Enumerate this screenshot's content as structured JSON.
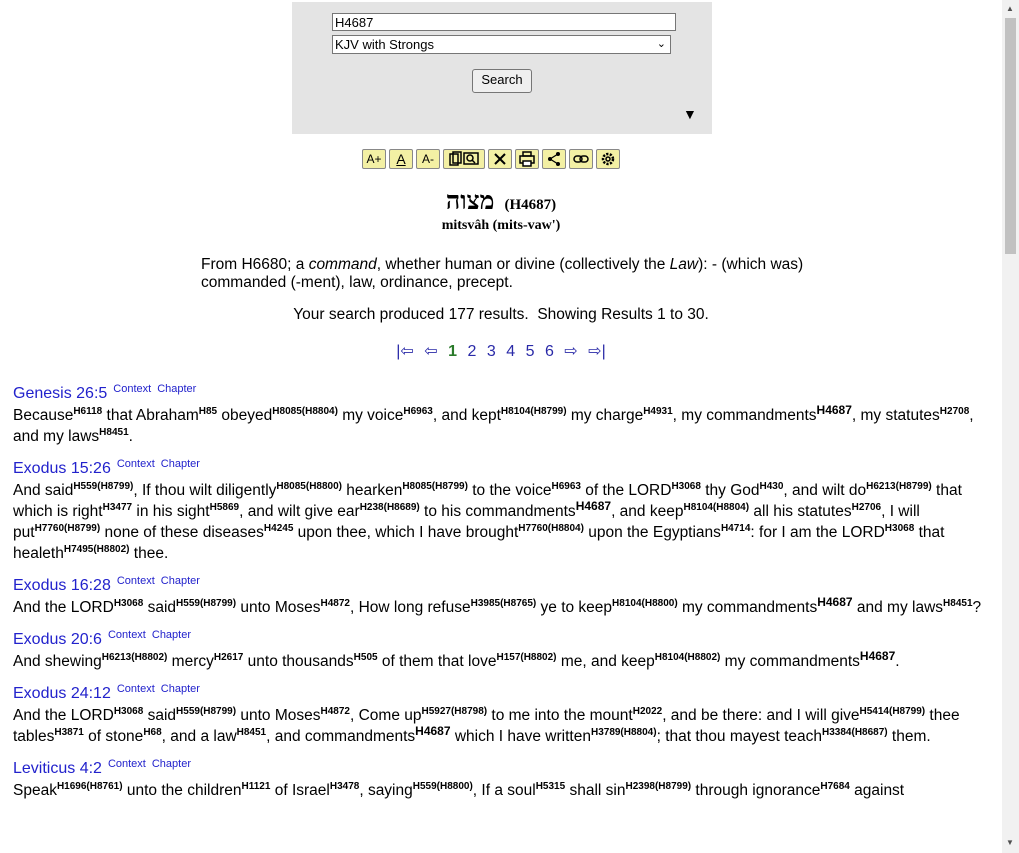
{
  "search": {
    "query": "H4687",
    "version": "KJV with Strongs",
    "button_label": "Search"
  },
  "toolbar": {
    "font_bigger": "A+",
    "font_normal": "A",
    "font_smaller": "A-"
  },
  "lexicon": {
    "hebrew": "מצוה",
    "strong": "(H4687)",
    "translit": "mitsvâh (mits-vaw')",
    "definition_parts": [
      "From H6680; a ",
      "command",
      ", whether human or divine (collectively the ",
      "Law",
      "): - (which was) commanded (-ment), law, ordinance, precept."
    ]
  },
  "result_count": "Your search produced 177 results.  Showing Results 1 to 30.",
  "pager": {
    "first": "|⇦",
    "prev": "⇦",
    "pages": [
      "1",
      "2",
      "3",
      "4",
      "5",
      "6"
    ],
    "next": "⇨",
    "last": "⇨|"
  },
  "link_labels": {
    "context": "Context",
    "chapter": "Chapter"
  },
  "verses": [
    {
      "ref": "Genesis 26:5",
      "segments": [
        [
          "Because",
          "H6118"
        ],
        [
          " that Abraham",
          "H85"
        ],
        [
          " obeyed",
          "H8085(H8804)"
        ],
        [
          " my voice",
          "H6963"
        ],
        [
          ", and kept",
          "H8104(H8799)"
        ],
        [
          " my charge",
          "H4931"
        ],
        [
          ", my commandments",
          "H4687"
        ],
        [
          ", my statutes",
          "H2708"
        ],
        [
          ", and my laws",
          "H8451"
        ],
        [
          ".",
          ""
        ]
      ]
    },
    {
      "ref": "Exodus 15:26",
      "segments": [
        [
          "And said",
          "H559(H8799)"
        ],
        [
          ", If thou wilt diligently",
          "H8085(H8800)"
        ],
        [
          " hearken",
          "H8085(H8799)"
        ],
        [
          " to the voice",
          "H6963"
        ],
        [
          " of the LORD",
          "H3068"
        ],
        [
          " thy God",
          "H430"
        ],
        [
          ", and wilt do",
          "H6213(H8799)"
        ],
        [
          " that which is right",
          "H3477"
        ],
        [
          " in his sight",
          "H5869"
        ],
        [
          ", and wilt give ear",
          "H238(H8689)"
        ],
        [
          " to his commandments",
          "H4687"
        ],
        [
          ", and keep",
          "H8104(H8804)"
        ],
        [
          " all his statutes",
          "H2706"
        ],
        [
          ", I will put",
          "H7760(H8799)"
        ],
        [
          " none of these diseases",
          "H4245"
        ],
        [
          " upon thee, which I have brought",
          "H7760(H8804)"
        ],
        [
          " upon the Egyptians",
          "H4714"
        ],
        [
          ": for I am the LORD",
          "H3068"
        ],
        [
          " that healeth",
          "H7495(H8802)"
        ],
        [
          " thee.",
          ""
        ]
      ]
    },
    {
      "ref": "Exodus 16:28",
      "segments": [
        [
          "And the LORD",
          "H3068"
        ],
        [
          " said",
          "H559(H8799)"
        ],
        [
          " unto Moses",
          "H4872"
        ],
        [
          ", How long refuse",
          "H3985(H8765)"
        ],
        [
          " ye to keep",
          "H8104(H8800)"
        ],
        [
          " my commandments",
          "H4687"
        ],
        [
          " and my laws",
          "H8451"
        ],
        [
          "?",
          ""
        ]
      ]
    },
    {
      "ref": "Exodus 20:6",
      "segments": [
        [
          "And shewing",
          "H6213(H8802)"
        ],
        [
          " mercy",
          "H2617"
        ],
        [
          " unto thousands",
          "H505"
        ],
        [
          " of them that love",
          "H157(H8802)"
        ],
        [
          " me, and keep",
          "H8104(H8802)"
        ],
        [
          " my commandments",
          "H4687"
        ],
        [
          ".",
          ""
        ]
      ]
    },
    {
      "ref": "Exodus 24:12",
      "segments": [
        [
          "And the LORD",
          "H3068"
        ],
        [
          " said",
          "H559(H8799)"
        ],
        [
          " unto Moses",
          "H4872"
        ],
        [
          ", Come up",
          "H5927(H8798)"
        ],
        [
          " to me into the mount",
          "H2022"
        ],
        [
          ", and be there: and I will give",
          "H5414(H8799)"
        ],
        [
          " thee tables",
          "H3871"
        ],
        [
          " of stone",
          "H68"
        ],
        [
          ", and a law",
          "H8451"
        ],
        [
          ", and commandments",
          "H4687"
        ],
        [
          " which I have written",
          "H3789(H8804)"
        ],
        [
          "; that thou mayest teach",
          "H3384(H8687)"
        ],
        [
          " them.",
          ""
        ]
      ]
    },
    {
      "ref": "Leviticus 4:2",
      "segments": [
        [
          "Speak",
          "H1696(H8761)"
        ],
        [
          " unto the children",
          "H1121"
        ],
        [
          " of Israel",
          "H3478"
        ],
        [
          ", saying",
          "H559(H8800)"
        ],
        [
          ", If a soul",
          "H5315"
        ],
        [
          " shall sin",
          "H2398(H8799)"
        ],
        [
          " through ignorance",
          "H7684"
        ],
        [
          " against",
          ""
        ]
      ]
    }
  ]
}
